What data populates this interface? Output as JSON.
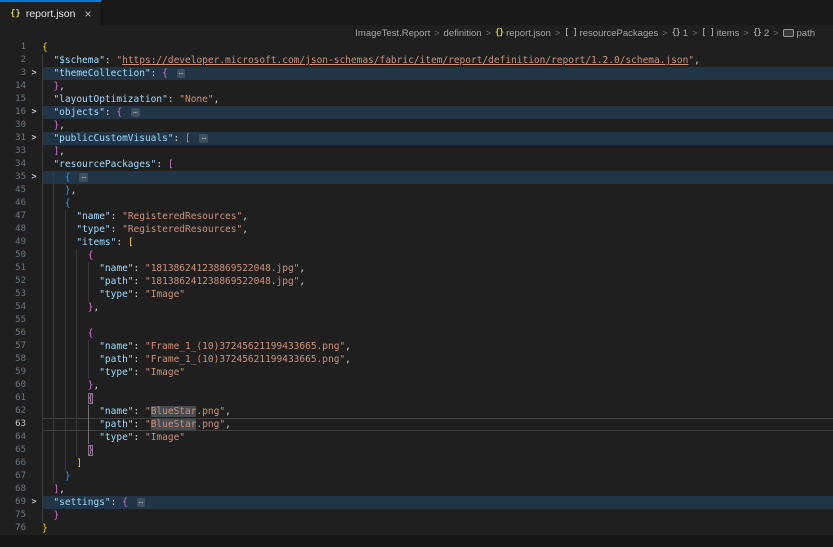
{
  "tab": {
    "label": "report.json"
  },
  "icons": {
    "json_braces": "{}",
    "object_braces": "{}",
    "array_brackets": "[ ]",
    "close": "×",
    "fold_chevron": ">",
    "fold_ellipsis": "⋯"
  },
  "colors": {
    "accent_blue": "#0078d4",
    "editor_bg": "#1f1f1f",
    "tabbar_bg": "#181818",
    "key": "#9cdcfe",
    "string": "#ce9178",
    "punctuation": "#d4d4d4",
    "bracket_level1": "#ffd700",
    "bracket_level2": "#da70d6",
    "bracket_level3": "#179fff",
    "json_icon": "#cbcb41",
    "folded_line_highlight": "rgba(38,79,120,0.45)"
  },
  "breadcrumbs": {
    "separator": ">",
    "items": [
      {
        "label": "ImageTest.Report"
      },
      {
        "label": "definition"
      },
      {
        "label": "report.json",
        "icon": "json"
      },
      {
        "label": "resourcePackages",
        "icon": "array"
      },
      {
        "label": "1",
        "icon": "object"
      },
      {
        "label": "items",
        "icon": "array"
      },
      {
        "label": "2",
        "icon": "object"
      },
      {
        "label": "path",
        "icon": "string"
      }
    ]
  },
  "editor": {
    "lines": [
      {
        "n": 1,
        "i": 0,
        "t": [
          [
            "{",
            "b1"
          ]
        ]
      },
      {
        "n": 2,
        "i": 2,
        "t": [
          [
            "\"$schema\"",
            "k"
          ],
          [
            ": ",
            "p"
          ],
          [
            "\"",
            "s"
          ],
          [
            "https://developer.microsoft.com/json-schemas/fabric/item/report/definition/report/1.2.0/schema.json",
            "u"
          ],
          [
            "\"",
            "s"
          ],
          [
            ",",
            "p"
          ]
        ]
      },
      {
        "n": 3,
        "i": 2,
        "fold": true,
        "t": [
          [
            "\"themeCollection\"",
            "k"
          ],
          [
            ": ",
            "p"
          ],
          [
            "{ ",
            "b2"
          ],
          [
            "⋯",
            "f"
          ]
        ]
      },
      {
        "n": 14,
        "i": 2,
        "t": [
          [
            "}",
            "b2"
          ],
          [
            ",",
            "p"
          ]
        ]
      },
      {
        "n": 15,
        "i": 2,
        "t": [
          [
            "\"layoutOptimization\"",
            "k"
          ],
          [
            ": ",
            "p"
          ],
          [
            "\"None\"",
            "s"
          ],
          [
            ",",
            "p"
          ]
        ]
      },
      {
        "n": 16,
        "i": 2,
        "fold": true,
        "t": [
          [
            "\"objects\"",
            "k"
          ],
          [
            ": ",
            "p"
          ],
          [
            "{ ",
            "b2"
          ],
          [
            "⋯",
            "f"
          ]
        ]
      },
      {
        "n": 30,
        "i": 2,
        "t": [
          [
            "}",
            "b2"
          ],
          [
            ",",
            "p"
          ]
        ]
      },
      {
        "n": 31,
        "i": 2,
        "fold": true,
        "t": [
          [
            "\"publicCustomVisuals\"",
            "k"
          ],
          [
            ": ",
            "p"
          ],
          [
            "[ ",
            "b2"
          ],
          [
            "⋯",
            "f"
          ]
        ]
      },
      {
        "n": 33,
        "i": 2,
        "t": [
          [
            "]",
            "b2"
          ],
          [
            ",",
            "p"
          ]
        ]
      },
      {
        "n": 34,
        "i": 2,
        "t": [
          [
            "\"resourcePackages\"",
            "k"
          ],
          [
            ": ",
            "p"
          ],
          [
            "[",
            "b2"
          ]
        ]
      },
      {
        "n": 35,
        "i": 4,
        "fold": true,
        "t": [
          [
            "{ ",
            "b3"
          ],
          [
            "⋯",
            "f"
          ]
        ]
      },
      {
        "n": 45,
        "i": 4,
        "t": [
          [
            "}",
            "b3"
          ],
          [
            ",",
            "p"
          ]
        ]
      },
      {
        "n": 46,
        "i": 4,
        "t": [
          [
            "{",
            "b3"
          ]
        ]
      },
      {
        "n": 47,
        "i": 6,
        "t": [
          [
            "\"name\"",
            "k"
          ],
          [
            ": ",
            "p"
          ],
          [
            "\"RegisteredResources\"",
            "s"
          ],
          [
            ",",
            "p"
          ]
        ]
      },
      {
        "n": 48,
        "i": 6,
        "t": [
          [
            "\"type\"",
            "k"
          ],
          [
            ": ",
            "p"
          ],
          [
            "\"RegisteredResources\"",
            "s"
          ],
          [
            ",",
            "p"
          ]
        ]
      },
      {
        "n": 49,
        "i": 6,
        "t": [
          [
            "\"items\"",
            "k"
          ],
          [
            ": ",
            "p"
          ],
          [
            "[",
            "b1"
          ]
        ]
      },
      {
        "n": 50,
        "i": 8,
        "t": [
          [
            "{",
            "b2"
          ]
        ]
      },
      {
        "n": 51,
        "i": 10,
        "t": [
          [
            "\"name\"",
            "k"
          ],
          [
            ": ",
            "p"
          ],
          [
            "\"181386241238869522048.jpg\"",
            "s"
          ],
          [
            ",",
            "p"
          ]
        ]
      },
      {
        "n": 52,
        "i": 10,
        "t": [
          [
            "\"path\"",
            "k"
          ],
          [
            ": ",
            "p"
          ],
          [
            "\"181386241238869522048.jpg\"",
            "s"
          ],
          [
            ",",
            "p"
          ]
        ]
      },
      {
        "n": 53,
        "i": 10,
        "t": [
          [
            "\"type\"",
            "k"
          ],
          [
            ": ",
            "p"
          ],
          [
            "\"Image\"",
            "s"
          ]
        ]
      },
      {
        "n": 54,
        "i": 8,
        "t": [
          [
            "}",
            "b2"
          ],
          [
            ",",
            "p"
          ]
        ]
      },
      {
        "n": 55,
        "i": 8,
        "t": []
      },
      {
        "n": 56,
        "i": 8,
        "t": [
          [
            "{",
            "b2"
          ]
        ]
      },
      {
        "n": 57,
        "i": 10,
        "t": [
          [
            "\"name\"",
            "k"
          ],
          [
            ": ",
            "p"
          ],
          [
            "\"Frame_1_(10)37245621199433665.png\"",
            "s"
          ],
          [
            ",",
            "p"
          ]
        ]
      },
      {
        "n": 58,
        "i": 10,
        "t": [
          [
            "\"path\"",
            "k"
          ],
          [
            ": ",
            "p"
          ],
          [
            "\"Frame_1_(10)37245621199433665.png\"",
            "s"
          ],
          [
            ",",
            "p"
          ]
        ]
      },
      {
        "n": 59,
        "i": 10,
        "t": [
          [
            "\"type\"",
            "k"
          ],
          [
            ": ",
            "p"
          ],
          [
            "\"Image\"",
            "s"
          ]
        ]
      },
      {
        "n": 60,
        "i": 8,
        "t": [
          [
            "}",
            "b2"
          ],
          [
            ",",
            "p"
          ]
        ]
      },
      {
        "n": 61,
        "i": 8,
        "t": [
          [
            "{",
            "b2 m"
          ]
        ]
      },
      {
        "n": 62,
        "i": 10,
        "ag": true,
        "t": [
          [
            "\"name\"",
            "k"
          ],
          [
            ": ",
            "p"
          ],
          [
            "\"",
            "s"
          ],
          [
            "BlueStar",
            "s w"
          ],
          [
            ".png\"",
            "s"
          ],
          [
            ",",
            "p"
          ]
        ]
      },
      {
        "n": 63,
        "i": 10,
        "cur": true,
        "ag": true,
        "t": [
          [
            "\"path\"",
            "k"
          ],
          [
            ": ",
            "p"
          ],
          [
            "\"",
            "s"
          ],
          [
            "BlueStar",
            "s w"
          ],
          [
            ".png\"",
            "s"
          ],
          [
            ",",
            "p"
          ]
        ]
      },
      {
        "n": 64,
        "i": 10,
        "ag": true,
        "t": [
          [
            "\"type\"",
            "k"
          ],
          [
            ": ",
            "p"
          ],
          [
            "\"Image\"",
            "s"
          ]
        ]
      },
      {
        "n": 65,
        "i": 8,
        "t": [
          [
            "}",
            "b2 m"
          ]
        ]
      },
      {
        "n": 66,
        "i": 6,
        "t": [
          [
            "]",
            "b1"
          ]
        ]
      },
      {
        "n": 67,
        "i": 4,
        "t": [
          [
            "}",
            "b3"
          ]
        ]
      },
      {
        "n": 68,
        "i": 2,
        "t": [
          [
            "]",
            "b2"
          ],
          [
            ",",
            "p"
          ]
        ]
      },
      {
        "n": 69,
        "i": 2,
        "fold": true,
        "t": [
          [
            "\"settings\"",
            "k"
          ],
          [
            ": ",
            "p"
          ],
          [
            "{ ",
            "b2"
          ],
          [
            "⋯",
            "f"
          ]
        ]
      },
      {
        "n": 75,
        "i": 2,
        "t": [
          [
            "}",
            "b2"
          ]
        ]
      },
      {
        "n": 76,
        "i": 0,
        "t": [
          [
            "}",
            "b1"
          ]
        ]
      }
    ]
  }
}
